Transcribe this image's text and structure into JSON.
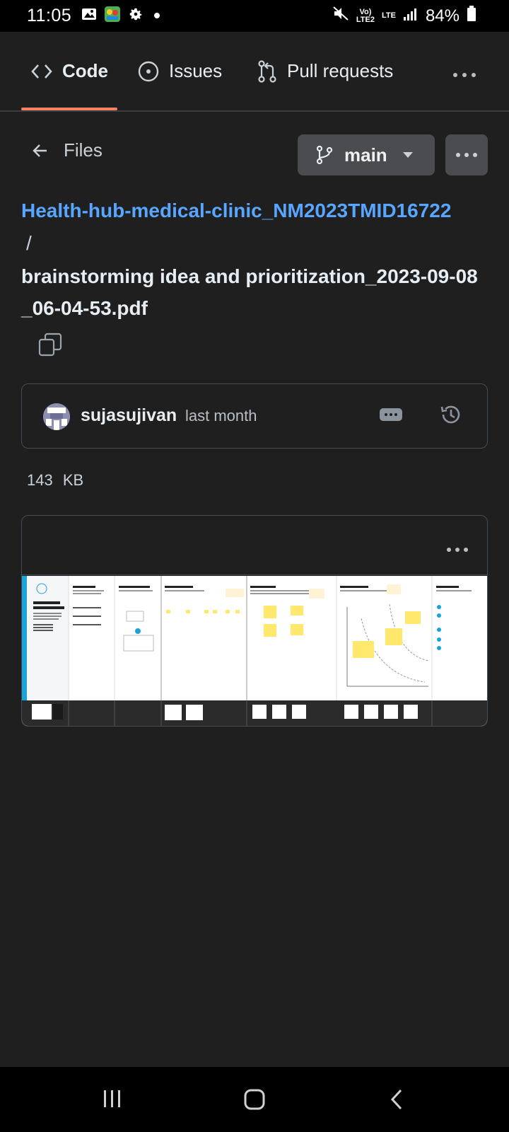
{
  "status_bar": {
    "time": "11:05",
    "network_top": "Vo)",
    "network_bottom": "LTE2",
    "lte": "LTE",
    "battery": "84%",
    "icons": [
      "image-icon",
      "game-icon",
      "gear-icon",
      "dot-icon",
      "mute-icon",
      "signal-icon",
      "battery-icon"
    ]
  },
  "tabs": [
    {
      "label": "Code",
      "icon": "code-icon",
      "active": true
    },
    {
      "label": "Issues",
      "icon": "issue-icon"
    },
    {
      "label": "Pull requests",
      "icon": "pull-request-icon"
    }
  ],
  "files": {
    "back_label": "Files",
    "branch": "main"
  },
  "path": {
    "repo": "Health-hub-medical-clinic_NM2023TMID16722",
    "separator": "/",
    "filename": "brainstorming idea and prioritization_2023-09-08_06-04-53.pdf"
  },
  "commit": {
    "user": "sujasujivan",
    "time": "last month"
  },
  "file_size": "143 KB",
  "colors": {
    "accent_link": "#58a6ff",
    "tab_underline": "#f78166",
    "background": "#1f1f1f"
  }
}
